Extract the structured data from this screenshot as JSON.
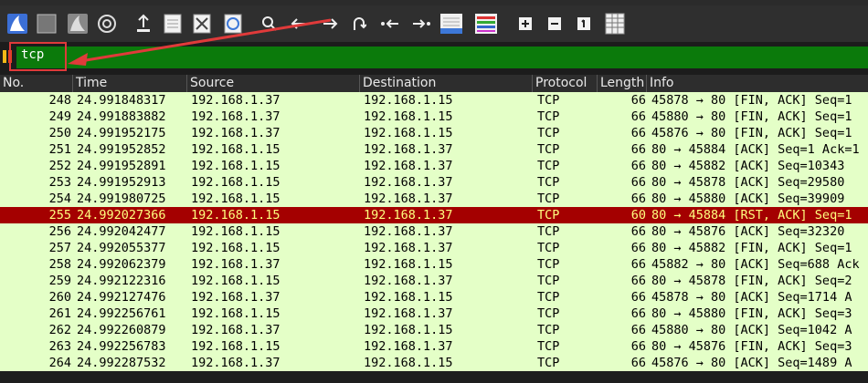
{
  "toolbar": {
    "icons": [
      "shark-fin-icon",
      "stop-icon",
      "restart-icon",
      "options-icon",
      "open-icon",
      "file-icon",
      "close-file-icon",
      "reload-icon",
      "find-icon",
      "back-icon",
      "forward-icon",
      "go-to-icon",
      "first-icon",
      "last-icon",
      "auto-scroll-icon",
      "colorize-icon",
      "zoom-in-icon",
      "zoom-out-icon",
      "normal-size-icon",
      "resize-columns-icon"
    ]
  },
  "filter": {
    "value": "tcp"
  },
  "columns": [
    "No.",
    "Time",
    "Source",
    "Destination",
    "Protocol",
    "Length",
    "Info"
  ],
  "packets": [
    {
      "no": "248",
      "time": "24.991848317",
      "src": "192.168.1.37",
      "dst": "192.168.1.15",
      "proto": "TCP",
      "len": "66",
      "info": "45878 → 80 [FIN, ACK] Seq=1",
      "rst": false
    },
    {
      "no": "249",
      "time": "24.991883882",
      "src": "192.168.1.37",
      "dst": "192.168.1.15",
      "proto": "TCP",
      "len": "66",
      "info": "45880 → 80 [FIN, ACK] Seq=1",
      "rst": false
    },
    {
      "no": "250",
      "time": "24.991952175",
      "src": "192.168.1.37",
      "dst": "192.168.1.15",
      "proto": "TCP",
      "len": "66",
      "info": "45876 → 80 [FIN, ACK] Seq=1",
      "rst": false
    },
    {
      "no": "251",
      "time": "24.991952852",
      "src": "192.168.1.15",
      "dst": "192.168.1.37",
      "proto": "TCP",
      "len": "66",
      "info": "80 → 45884 [ACK] Seq=1 Ack=1",
      "rst": false
    },
    {
      "no": "252",
      "time": "24.991952891",
      "src": "192.168.1.15",
      "dst": "192.168.1.37",
      "proto": "TCP",
      "len": "66",
      "info": "80 → 45882 [ACK] Seq=10343",
      "rst": false
    },
    {
      "no": "253",
      "time": "24.991952913",
      "src": "192.168.1.15",
      "dst": "192.168.1.37",
      "proto": "TCP",
      "len": "66",
      "info": "80 → 45878 [ACK] Seq=29580",
      "rst": false
    },
    {
      "no": "254",
      "time": "24.991980725",
      "src": "192.168.1.15",
      "dst": "192.168.1.37",
      "proto": "TCP",
      "len": "66",
      "info": "80 → 45880 [ACK] Seq=39909",
      "rst": false
    },
    {
      "no": "255",
      "time": "24.992027366",
      "src": "192.168.1.15",
      "dst": "192.168.1.37",
      "proto": "TCP",
      "len": "60",
      "info": "80 → 45884 [RST, ACK] Seq=1",
      "rst": true
    },
    {
      "no": "256",
      "time": "24.992042477",
      "src": "192.168.1.15",
      "dst": "192.168.1.37",
      "proto": "TCP",
      "len": "66",
      "info": "80 → 45876 [ACK] Seq=32320",
      "rst": false
    },
    {
      "no": "257",
      "time": "24.992055377",
      "src": "192.168.1.15",
      "dst": "192.168.1.37",
      "proto": "TCP",
      "len": "66",
      "info": "80 → 45882 [FIN, ACK] Seq=1",
      "rst": false
    },
    {
      "no": "258",
      "time": "24.992062379",
      "src": "192.168.1.37",
      "dst": "192.168.1.15",
      "proto": "TCP",
      "len": "66",
      "info": "45882 → 80 [ACK] Seq=688 Ack",
      "rst": false
    },
    {
      "no": "259",
      "time": "24.992122316",
      "src": "192.168.1.15",
      "dst": "192.168.1.37",
      "proto": "TCP",
      "len": "66",
      "info": "80 → 45878 [FIN, ACK] Seq=2",
      "rst": false
    },
    {
      "no": "260",
      "time": "24.992127476",
      "src": "192.168.1.37",
      "dst": "192.168.1.15",
      "proto": "TCP",
      "len": "66",
      "info": "45878 → 80 [ACK] Seq=1714 A",
      "rst": false
    },
    {
      "no": "261",
      "time": "24.992256761",
      "src": "192.168.1.15",
      "dst": "192.168.1.37",
      "proto": "TCP",
      "len": "66",
      "info": "80 → 45880 [FIN, ACK] Seq=3",
      "rst": false
    },
    {
      "no": "262",
      "time": "24.992260879",
      "src": "192.168.1.37",
      "dst": "192.168.1.15",
      "proto": "TCP",
      "len": "66",
      "info": "45880 → 80 [ACK] Seq=1042 A",
      "rst": false
    },
    {
      "no": "263",
      "time": "24.992256783",
      "src": "192.168.1.15",
      "dst": "192.168.1.37",
      "proto": "TCP",
      "len": "66",
      "info": "80 → 45876 [FIN, ACK] Seq=3",
      "rst": false
    },
    {
      "no": "264",
      "time": "24.992287532",
      "src": "192.168.1.37",
      "dst": "192.168.1.15",
      "proto": "TCP",
      "len": "66",
      "info": "45876 → 80 [ACK] Seq=1489 A",
      "rst": false
    }
  ],
  "colors": {
    "tcp_row_bg": "#e4ffc7",
    "rst_row_bg": "#a40000",
    "rst_row_fg": "#ffff7f",
    "filter_bg": "#0b7a0b",
    "highlight": "#e03a3a"
  }
}
